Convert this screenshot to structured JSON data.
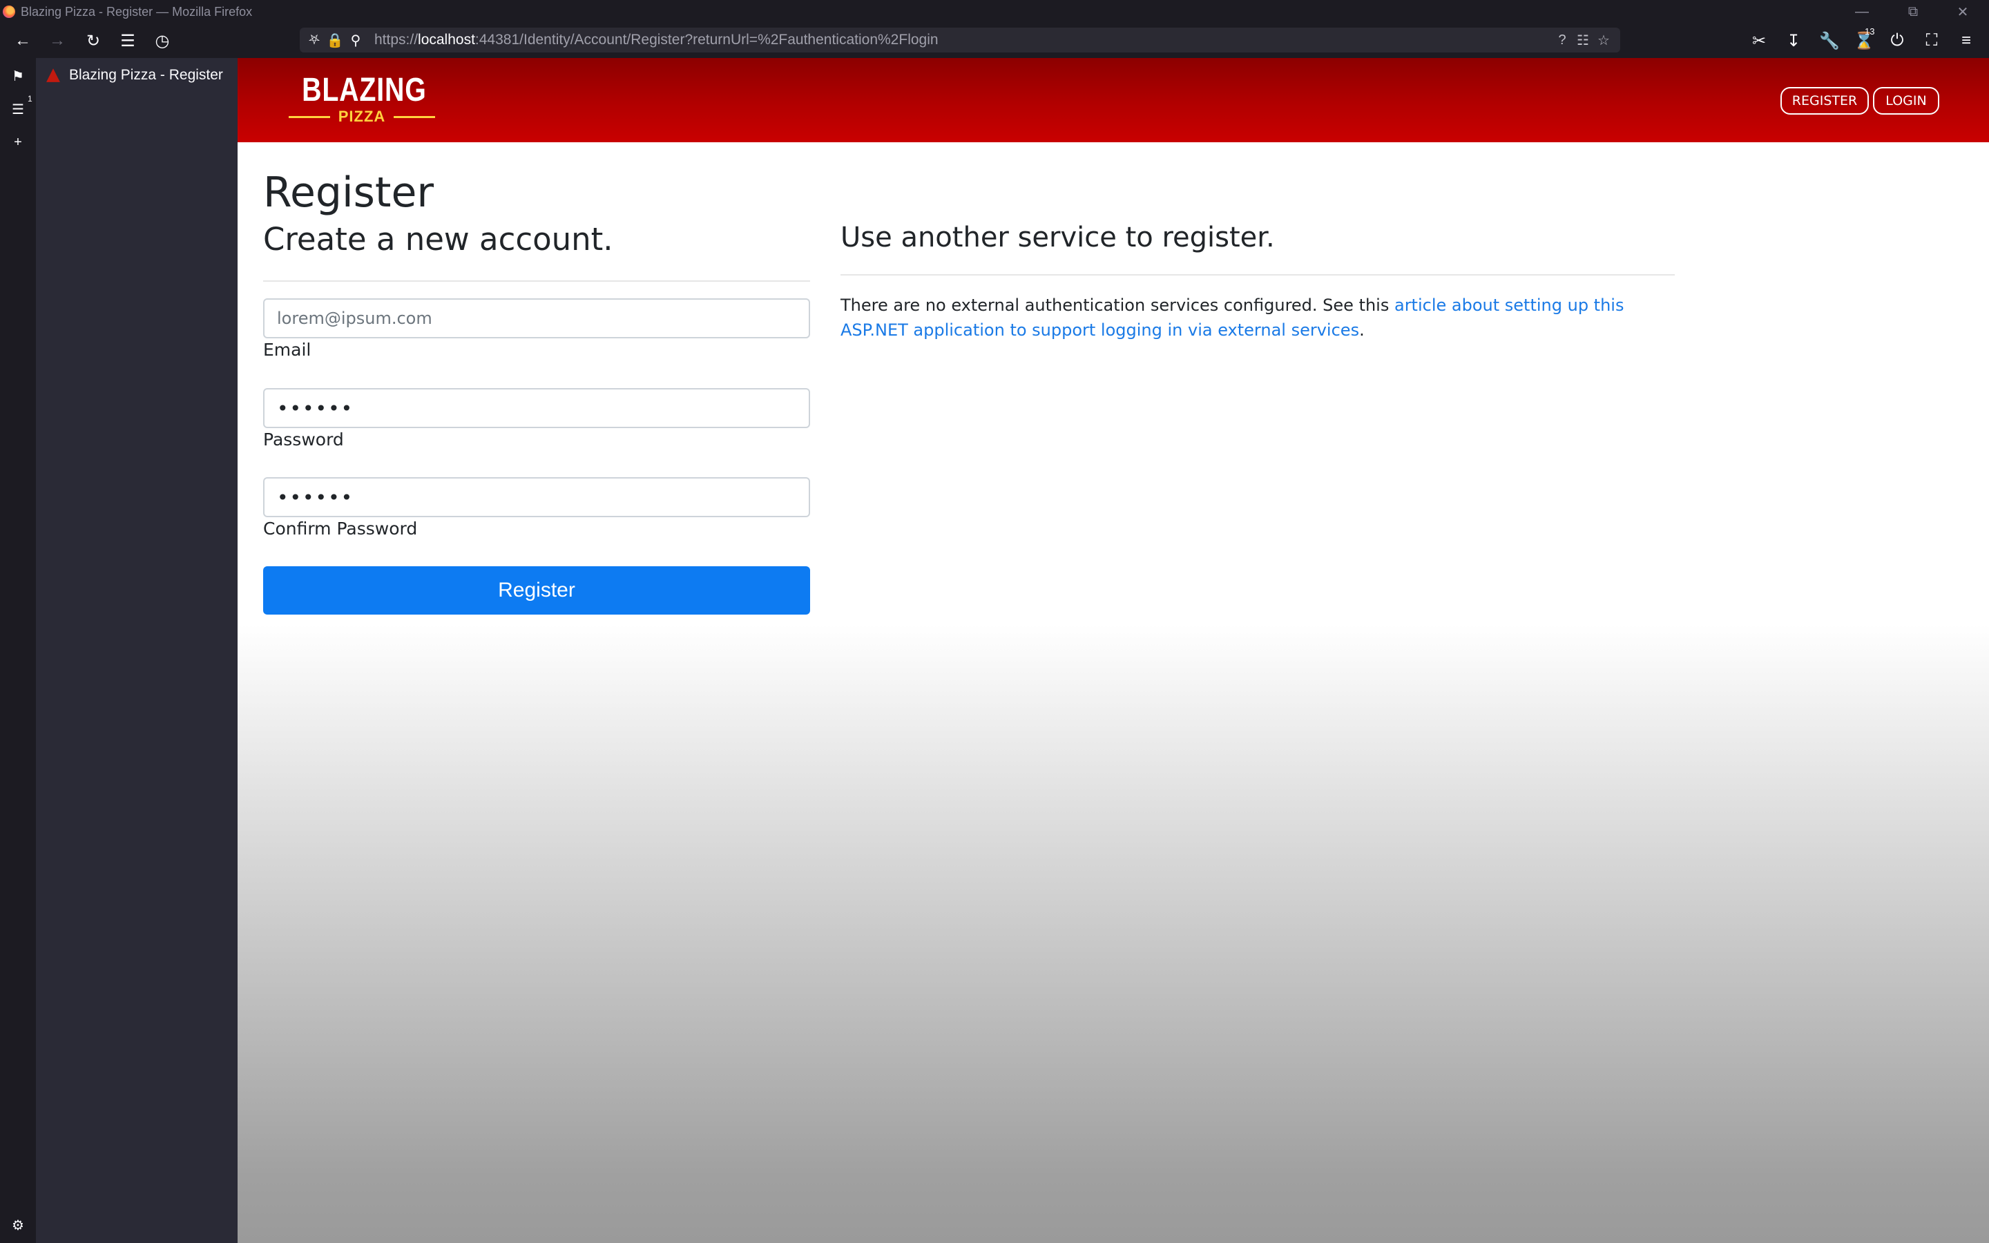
{
  "browser": {
    "window_title": "Blazing Pizza - Register — Mozilla Firefox",
    "url_prefix": "https://",
    "url_host": "localhost",
    "url_rest": ":44381/Identity/Account/Register?returnUrl=%2Fauthentication%2Flogin",
    "extension_badge": "13",
    "sidebar_badge": "1",
    "tab": {
      "label": "Blazing Pizza - Register"
    }
  },
  "site": {
    "logo_main": "BLAZING",
    "logo_sub": "PIZZA",
    "nav": {
      "register_label": "REGISTER",
      "login_label": "LOGIN"
    }
  },
  "page": {
    "title": "Register",
    "subtitle": "Create a new account.",
    "form": {
      "email": {
        "value": "lorem@ipsum.com",
        "label": "Email"
      },
      "password": {
        "masked_value": "••••••",
        "label": "Password"
      },
      "confirm_password": {
        "masked_value": "••••••",
        "label": "Confirm Password"
      },
      "submit_label": "Register"
    },
    "external": {
      "title": "Use another service to register.",
      "text_before": "There are no external authentication services configured. See this ",
      "link_text": "article about setting up this ASP.NET application to support logging in via external services",
      "text_after": "."
    }
  },
  "colors": {
    "header_red": "#b20000",
    "logo_yellow": "#ffd23f",
    "primary_button": "#0d7bf2",
    "link": "#1a7ae6"
  }
}
